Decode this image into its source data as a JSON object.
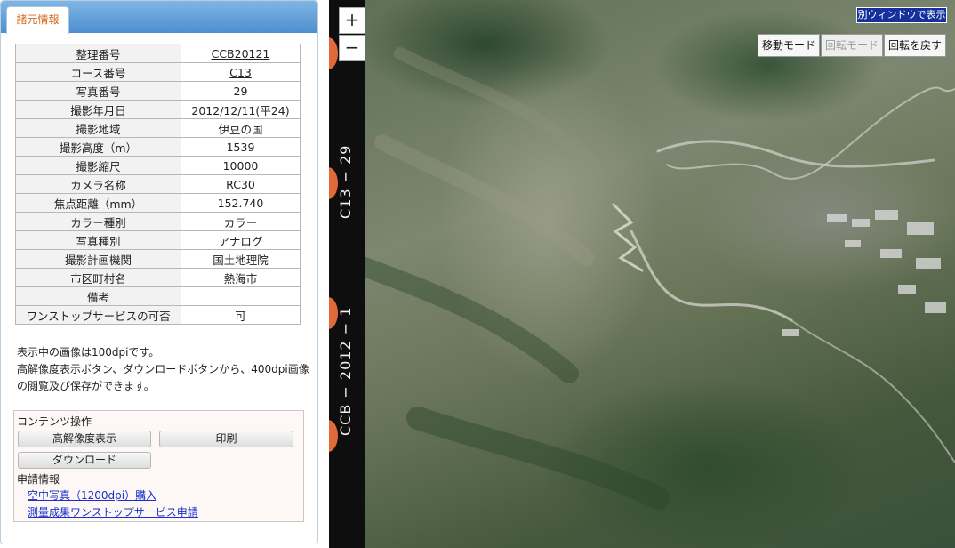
{
  "tab": {
    "label": "諸元情報"
  },
  "info_rows": [
    {
      "key": "整理番号",
      "value": "CCB20121",
      "link": true
    },
    {
      "key": "コース番号",
      "value": "C13",
      "link": true
    },
    {
      "key": "写真番号",
      "value": "29"
    },
    {
      "key": "撮影年月日",
      "value": "2012/12/11(平24)"
    },
    {
      "key": "撮影地域",
      "value": "伊豆の国"
    },
    {
      "key": "撮影高度（m）",
      "value": "1539"
    },
    {
      "key": "撮影縮尺",
      "value": "10000"
    },
    {
      "key": "カメラ名称",
      "value": "RC30"
    },
    {
      "key": "焦点距離（mm）",
      "value": "152.740"
    },
    {
      "key": "カラー種別",
      "value": "カラー"
    },
    {
      "key": "写真種別",
      "value": "アナログ"
    },
    {
      "key": "撮影計画機関",
      "value": "国土地理院"
    },
    {
      "key": "市区町村名",
      "value": "熱海市"
    },
    {
      "key": "備考",
      "value": ""
    },
    {
      "key": "ワンストップサービスの可否",
      "value": "可"
    }
  ],
  "note": {
    "line1": "表示中の画像は100dpiです。",
    "line2": "高解像度表示ボタン、ダウンロードボタンから、400dpi画像の閲覧及び保存ができます。"
  },
  "ops": {
    "heading": "コンテンツ操作",
    "hires_label": "高解像度表示",
    "print_label": "印刷",
    "download_label": "ダウンロード",
    "apply_heading": "申請情報",
    "purchase_link": "空中写真（1200dpi）購入",
    "onestop_link": "測量成果ワンストップサービス申請"
  },
  "map": {
    "zoom_in": "+",
    "zoom_out": "−",
    "separate_window": "別ウィンドウで表示",
    "move_mode": "移動モード",
    "rotate_mode": "回転モード",
    "reset_rotation": "回転を戻す",
    "film_top_text": "C13 − 29",
    "film_bottom_text": "CCB − 2012 − 1"
  },
  "colors": {
    "tab_gradient_top": "#7fb6e4",
    "tab_gradient_bottom": "#4e8fcf",
    "tab_text": "#d2691e",
    "link": "#1a2fc9",
    "film_mark": "#e06a3a",
    "separate_window_bg": "#14309a"
  }
}
